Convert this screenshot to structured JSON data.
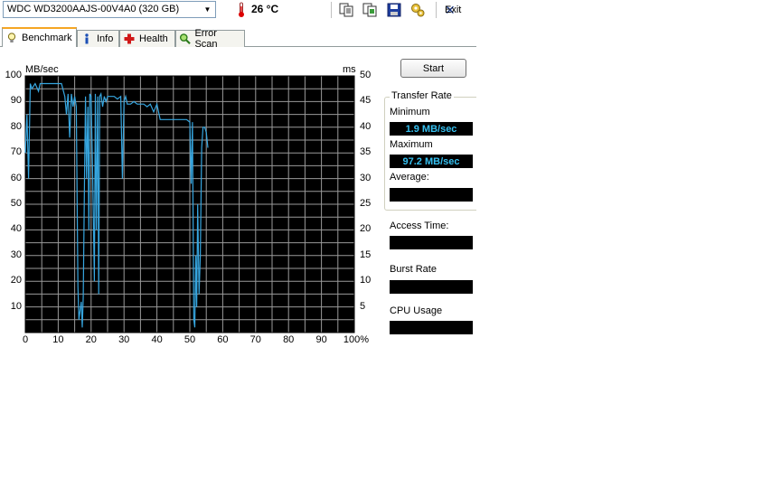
{
  "toolbar": {
    "drive": "WDC WD3200AAJS-00V4A0 (320 GB)",
    "temperature": "26 °C",
    "exit_label": "Exit"
  },
  "tabs": [
    {
      "label": "Benchmark",
      "active": true
    },
    {
      "label": "Info",
      "active": false
    },
    {
      "label": "Health",
      "active": false
    },
    {
      "label": "Error Scan",
      "active": false
    }
  ],
  "chart": {
    "left_unit": "MB/sec",
    "right_unit": "ms",
    "left_ticks": [
      "100",
      "90",
      "80",
      "70",
      "60",
      "50",
      "40",
      "30",
      "20",
      "10"
    ],
    "right_ticks": [
      "50",
      "45",
      "40",
      "35",
      "30",
      "25",
      "20",
      "15",
      "10",
      "5"
    ],
    "x_ticks": [
      "0",
      "10",
      "20",
      "30",
      "40",
      "50",
      "60",
      "70",
      "80",
      "90",
      "100%"
    ]
  },
  "chart_data": {
    "type": "line",
    "xlim": [
      0,
      100
    ],
    "ylim": [
      0,
      100
    ],
    "y2lim": [
      0,
      50
    ],
    "grid": true,
    "series": [
      {
        "color": "#36a6e0",
        "x": [
          0,
          0.5,
          1,
          1.5,
          2,
          3,
          4,
          4.5,
          5,
          7,
          9,
          11,
          12,
          12.5,
          13,
          13.5,
          14,
          14.5,
          15,
          15.5,
          16,
          16.3,
          16.6,
          17,
          17.3,
          17.6,
          18,
          18.3,
          18.6,
          19,
          19.3,
          19.6,
          20,
          20.5,
          21,
          21.3,
          21.6,
          22,
          22.3,
          22.6,
          23,
          23.5,
          24,
          24.5,
          25,
          26,
          27,
          28,
          29,
          29.5,
          30,
          30.5,
          31,
          32,
          33,
          34,
          35,
          36,
          37,
          38,
          39,
          40,
          41,
          42,
          43,
          44,
          45,
          46,
          47,
          48,
          49,
          50,
          50.4,
          50.8,
          51.2,
          51.5,
          51.8,
          52.1,
          52.4,
          52.8,
          53.2,
          53.6,
          54,
          54.5,
          55,
          55.5
        ],
        "values": [
          70,
          85,
          60,
          97,
          95,
          97,
          94,
          97,
          97,
          97,
          97,
          97,
          92,
          85,
          93,
          76,
          93,
          88,
          92,
          88,
          18,
          5,
          8,
          12,
          2,
          14,
          60,
          92,
          60,
          88,
          40,
          93,
          92,
          60,
          20,
          93,
          40,
          92,
          15,
          92,
          93,
          88,
          92,
          90,
          92,
          92,
          92,
          91,
          92,
          60,
          90,
          92,
          89,
          89,
          90,
          89,
          89,
          89,
          88,
          89,
          86,
          89,
          83,
          83,
          83,
          83,
          83,
          83,
          83,
          83,
          83,
          82,
          58,
          82,
          5,
          2,
          30,
          10,
          50,
          15,
          30,
          72,
          80,
          80,
          78,
          72
        ]
      }
    ]
  },
  "controls": {
    "start_label": "Start",
    "group_title": "Transfer Rate",
    "minimum_label": "Minimum",
    "minimum_value": "1.9 MB/sec",
    "maximum_label": "Maximum",
    "maximum_value": "97.2 MB/sec",
    "average_label": "Average:",
    "average_value": "",
    "access_label": "Access Time:",
    "access_value": "",
    "burst_label": "Burst Rate",
    "burst_value": "",
    "cpu_label": "CPU Usage",
    "cpu_value": ""
  }
}
